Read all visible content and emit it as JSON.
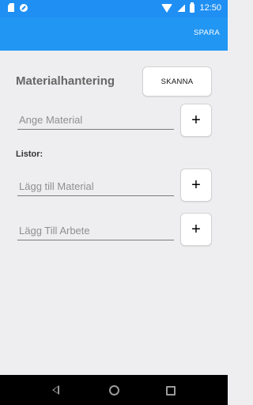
{
  "status_bar": {
    "time": "12:50",
    "icons": [
      "sd-card-icon",
      "sync-icon",
      "wifi-icon",
      "signal-icon",
      "battery-icon"
    ],
    "color": "#1f8ff3"
  },
  "app_bar": {
    "action_label": "SPARA",
    "color": "#2196f3"
  },
  "main": {
    "title": "Materialhantering",
    "scan_button_label": "SKANNA",
    "material_field": {
      "placeholder": "Ange Material",
      "value": ""
    },
    "material_add_label": "+",
    "lists_label": "Listor:",
    "add_material_field": {
      "placeholder": "Lägg till Material",
      "value": ""
    },
    "add_material_button_label": "+",
    "add_work_field": {
      "placeholder": "Lägg Till Arbete",
      "value": ""
    },
    "add_work_button_label": "+"
  },
  "nav_bar": {
    "icons": [
      "back-icon",
      "home-icon",
      "recents-icon"
    ]
  }
}
